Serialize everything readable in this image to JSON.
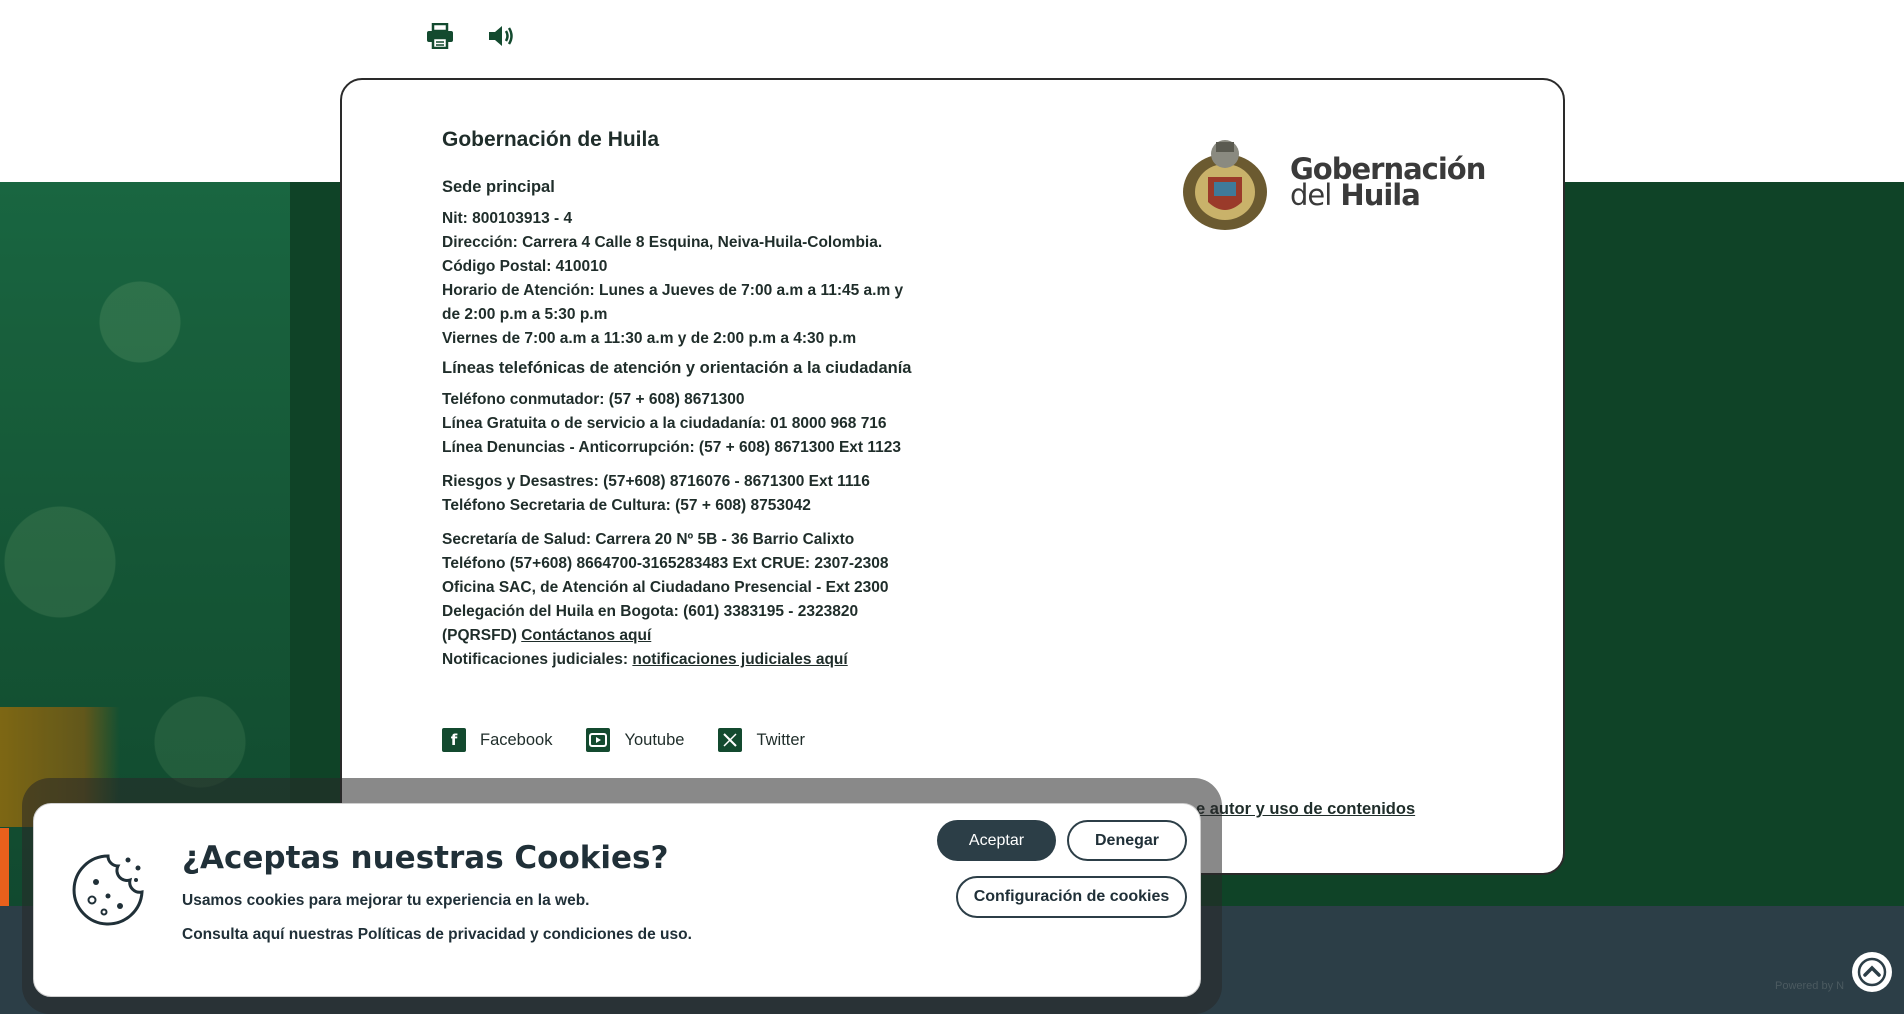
{
  "tools": {
    "print_icon": "print-icon",
    "audio_icon": "speaker-icon"
  },
  "footer": {
    "org_title": "Gobernación de Huila",
    "sede_heading": "Sede principal",
    "sede_lines": [
      "Nit: 800103913 - 4",
      "Dirección: Carrera 4 Calle 8 Esquina, Neiva-Huila-Colombia.",
      "Código Postal: 410010",
      "Horario de Atención: Lunes a Jueves de 7:00 a.m a 11:45 a.m y",
      "de 2:00 p.m a 5:30 p.m",
      "Viernes de 7:00 a.m a 11:30 a.m y de 2:00 p.m a 4:30 p.m"
    ],
    "lines_heading": "Líneas telefónicas de atención y orientación a la ciudadanía",
    "phone_lines": [
      "Teléfono conmutador: (57 + 608) 8671300",
      "Línea Gratuita o de servicio a la ciudadanía: 01 8000 968 716",
      "Línea Denuncias - Anticorrupción: (57 + 608) 8671300 Ext 1123"
    ],
    "other_lines": [
      "Riesgos y Desastres: (57+608) 8716076 - 8671300 Ext 1116",
      "Teléfono Secretaria de Cultura: (57 + 608) 8753042"
    ],
    "health_lines": [
      "Secretaría de Salud: Carrera 20 Nº 5B - 36 Barrio Calixto",
      "Teléfono (57+608) 8664700-3165283483 Ext CRUE: 2307-2308",
      "Oficina SAC, de Atención al Ciudadano Presencial - Ext 2300",
      "Delegación del Huila en Bogota: (601) 3383195 - 2323820"
    ],
    "pqrsfd_prefix": "(PQRSFD)",
    "pqrsfd_link": "Contáctanos aquí",
    "notif_prefix": "Notificaciones judiciales:",
    "notif_link": "notificaciones judiciales aquí",
    "social": [
      {
        "label": "Facebook",
        "icon": "facebook-icon"
      },
      {
        "label": "Youtube",
        "icon": "youtube-icon"
      },
      {
        "label": "Twitter",
        "icon": "twitter-x-icon"
      }
    ],
    "logo_line1": "Gobernación",
    "logo_line2_a": "del",
    "logo_line2_b": "Huila",
    "rights_link": "e autor y uso de contenidos"
  },
  "cookies": {
    "title": "¿Aceptas nuestras Cookies?",
    "text1": "Usamos cookies para mejorar tu experiencia en la web.",
    "text2": "Consulta aquí nuestras Políticas de privacidad y condiciones de uso.",
    "accept": "Aceptar",
    "deny": "Denegar",
    "config": "Configuración de cookies"
  },
  "bottom": {
    "powered": "Powered by N"
  },
  "colors": {
    "brand_green": "#0f4327",
    "slate": "#2c3e47",
    "accent_orange": "#e8601c"
  }
}
